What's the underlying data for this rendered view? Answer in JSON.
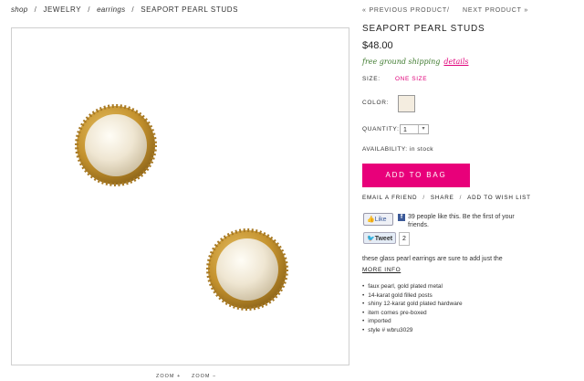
{
  "breadcrumb": [
    "shop",
    "JEWELRY",
    "earrings",
    "SEAPORT PEARL STUDS"
  ],
  "product_nav": {
    "prev": "« PREVIOUS PRODUCT",
    "next": "NEXT PRODUCT »"
  },
  "product": {
    "title": "SEAPORT PEARL STUDS",
    "price": "$48.00",
    "shipping": "free ground shipping",
    "shipping_link": "details",
    "size_label": "SIZE:",
    "size_value": "ONE SIZE",
    "color_label": "COLOR:",
    "swatch_color": "#f4ede0",
    "quantity_label": "QUANTITY:",
    "quantity_value": "1",
    "availability": "AVAILABILITY: in stock",
    "add_to_bag": "ADD TO BAG",
    "accent_color": "#e8007a"
  },
  "share": {
    "email": "EMAIL A FRIEND",
    "share": "SHARE",
    "wishlist": "ADD TO WISH LIST"
  },
  "social": {
    "like_label": "Like",
    "like_text": "39 people like this. Be the first of your friends.",
    "tweet_label": "Tweet",
    "tweet_count": "2"
  },
  "description": {
    "text": "these glass pearl earrings are sure to add just the",
    "more": "MORE INFO"
  },
  "details": [
    "faux pearl, gold plated metal",
    "14-karat gold filled posts",
    "shiny 12-karat gold plated hardware",
    "item comes pre-boxed",
    "imported",
    "style # wbru3029"
  ],
  "zoom": [
    "ZOOM +",
    "ZOOM −"
  ]
}
